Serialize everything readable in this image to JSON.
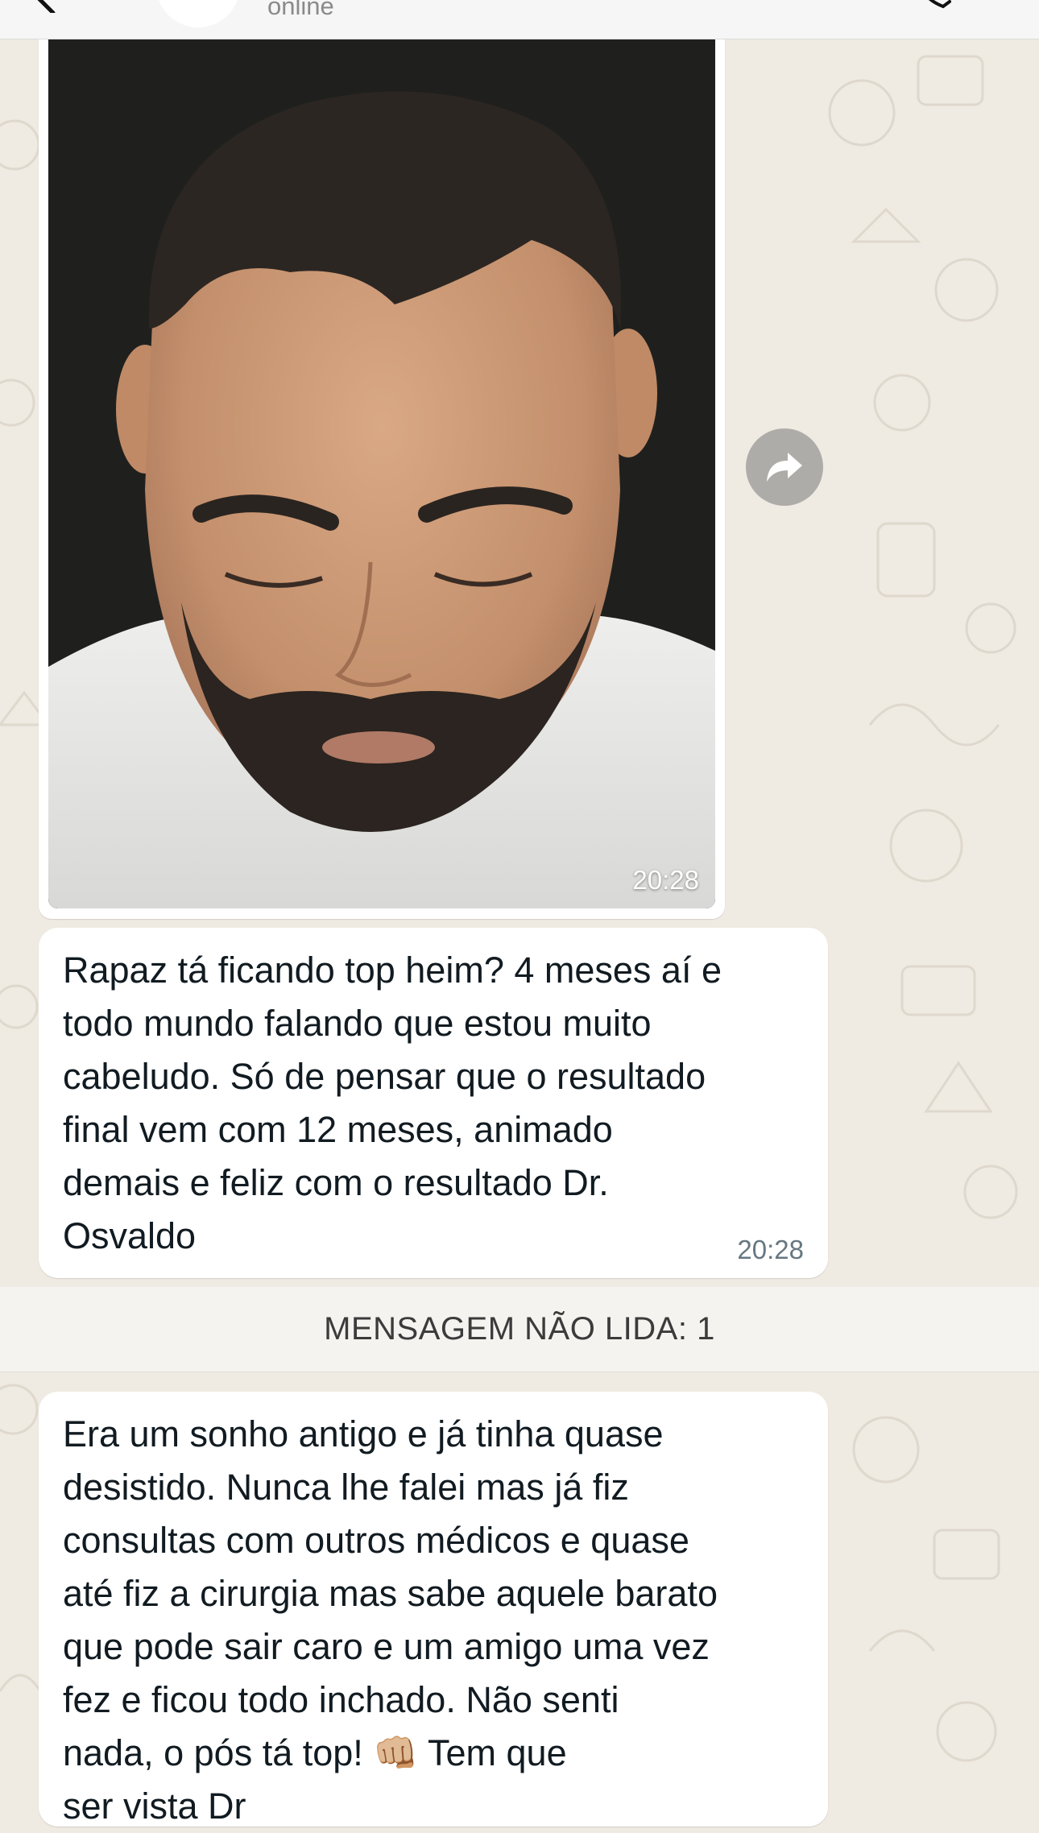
{
  "header": {
    "status": "online"
  },
  "messages": [
    {
      "type": "image",
      "time": "20:28"
    },
    {
      "type": "text",
      "lines": [
        "Rapaz tá ficando top heim? 4 meses aí e",
        "todo mundo falando que estou muito",
        "cabeludo. Só de pensar que o resultado",
        "final vem com 12 meses, animado",
        "demais e feliz com o resultado Dr.",
        "Osvaldo"
      ],
      "time": "20:28"
    },
    {
      "type": "text",
      "lines": [
        "Era um sonho antigo e já tinha quase",
        "desistido. Nunca lhe falei mas já fiz",
        "consultas com outros médicos e quase",
        "até fiz a cirurgia mas sabe aquele barato",
        "que pode sair caro e um amigo uma vez",
        "fez e ficou todo inchado. Não senti",
        "nada, o pós tá top! 👊🏼 Tem que",
        "ser vista Dr"
      ]
    }
  ],
  "unread_divider": "MENSAGEM NÃO LIDA: 1",
  "icons": {
    "back": "chevron-left-icon",
    "call": "phone-icon",
    "forward": "forward-arrow-icon"
  },
  "colors": {
    "chat_background": "#efeae2",
    "bubble": "#ffffff",
    "timestamp": "#667781",
    "forward_button": "#8c8c8c"
  }
}
